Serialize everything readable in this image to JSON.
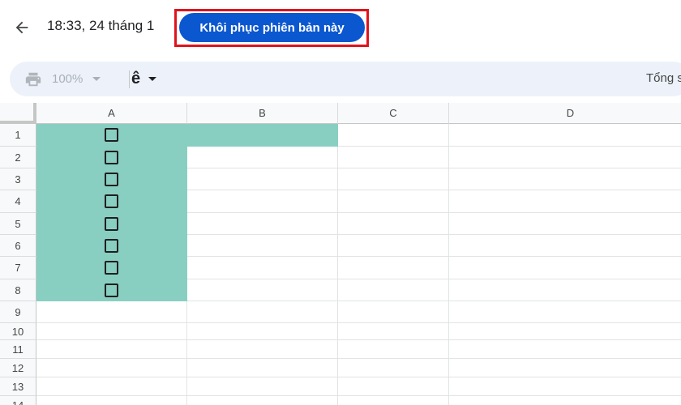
{
  "header": {
    "version_title": "18:33, 24 tháng 1",
    "restore_button_label": "Khôi phục phiên bản này",
    "highlight_color": "#e0131c",
    "accent_color": "#0b57d0"
  },
  "toolbar": {
    "zoom_value": "100%",
    "input_tools_glyph": "ê",
    "sum_label": "Tổng s"
  },
  "grid": {
    "columns": [
      "A",
      "B",
      "C",
      "D"
    ],
    "rows": [
      "1",
      "2",
      "3",
      "4",
      "5",
      "6",
      "7",
      "8",
      "9",
      "10",
      "11",
      "12",
      "13",
      "14"
    ],
    "fill_color": "#88cfc2",
    "filled_cells": [
      "A1",
      "B1",
      "A2",
      "A3",
      "A4",
      "A5",
      "A6",
      "A7",
      "A8"
    ],
    "checkbox_cells": [
      "A1",
      "A2",
      "A3",
      "A4",
      "A5",
      "A6",
      "A7",
      "A8"
    ]
  }
}
